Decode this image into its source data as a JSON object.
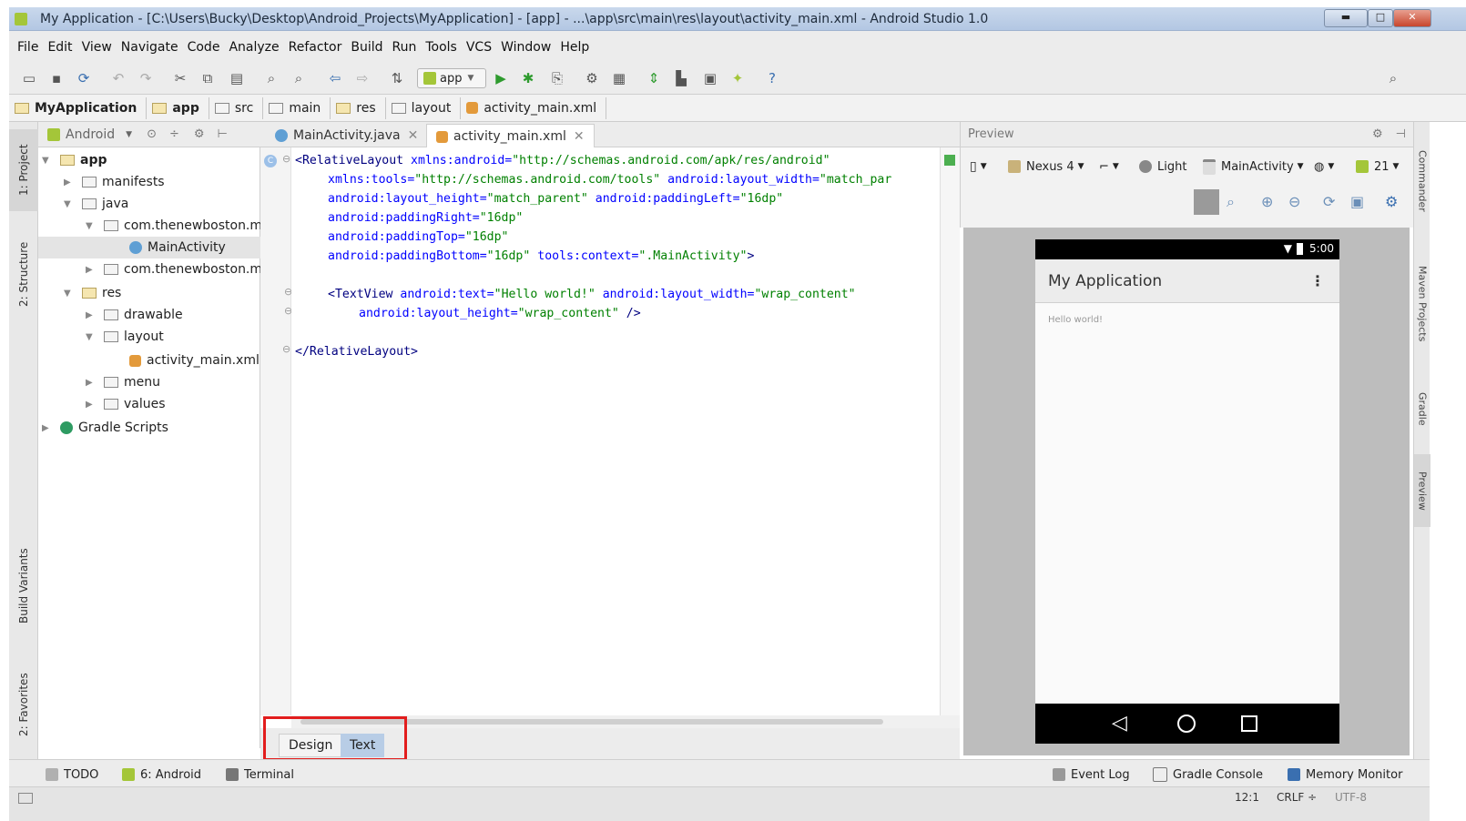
{
  "window": {
    "title": "My Application - [C:\\Users\\Bucky\\Desktop\\Android_Projects\\MyApplication] - [app] - ...\\app\\src\\main\\res\\layout\\activity_main.xml - Android Studio 1.0"
  },
  "menu": [
    "File",
    "Edit",
    "View",
    "Navigate",
    "Code",
    "Analyze",
    "Refactor",
    "Build",
    "Run",
    "Tools",
    "VCS",
    "Window",
    "Help"
  ],
  "toolbar": {
    "run_config": "app",
    "help": "?"
  },
  "breadcrumb": [
    "MyApplication",
    "app",
    "src",
    "main",
    "res",
    "layout",
    "activity_main.xml"
  ],
  "side_tabs": {
    "project": "1: Project",
    "structure": "2: Structure",
    "build_variants": "Build Variants",
    "favorites": "2: Favorites"
  },
  "project_panel": {
    "view": "Android"
  },
  "tree": {
    "app": "app",
    "manifests": "manifests",
    "java": "java",
    "pkg1": "com.thenewboston.m",
    "main_activity": "MainActivity",
    "pkg2": "com.thenewboston.m",
    "res": "res",
    "drawable": "drawable",
    "layout": "layout",
    "activity_main": "activity_main.xml",
    "menu": "menu",
    "values": "values",
    "gradle": "Gradle Scripts"
  },
  "editor_tabs": [
    "MainActivity.java",
    "activity_main.xml"
  ],
  "code": {
    "l1": [
      "<RelativeLayout ",
      "xmlns:android=",
      "\"http://schemas.android.com/apk/res/android\""
    ],
    "l2": [
      "xmlns:tools=",
      "\"http://schemas.android.com/tools\"",
      " android:layout_width=",
      "\"match_par"
    ],
    "l3": [
      "android:layout_height=",
      "\"match_parent\"",
      " android:paddingLeft=",
      "\"16dp\""
    ],
    "l4": [
      "android:paddingRight=",
      "\"16dp\""
    ],
    "l5": [
      "android:paddingTop=",
      "\"16dp\""
    ],
    "l6": [
      "android:paddingBottom=",
      "\"16dp\"",
      " tools:context=",
      "\".MainActivity\"",
      ">"
    ],
    "l8": [
      "<TextView ",
      "android:text=",
      "\"Hello world!\"",
      " android:layout_width=",
      "\"wrap_content\""
    ],
    "l9": [
      "android:layout_height=",
      "\"wrap_content\"",
      " />"
    ],
    "l11": "</RelativeLayout>"
  },
  "design_tabs": {
    "design": "Design",
    "text": "Text"
  },
  "preview": {
    "title": "Preview",
    "device": "Nexus 4",
    "theme": "Light",
    "activity": "MainActivity",
    "api": "21",
    "time": "5:00",
    "app_title": "My Application",
    "hello": "Hello world!"
  },
  "right_tabs": {
    "commander": "Commander",
    "maven": "Maven Projects",
    "gradle": "Gradle",
    "preview": "Preview"
  },
  "bottom_tools": {
    "todo": "TODO",
    "android": "6: Android",
    "terminal": "Terminal",
    "event_log": "Event Log",
    "gradle_console": "Gradle Console",
    "memory_monitor": "Memory Monitor"
  },
  "status": {
    "position": "12:1",
    "line_sep": "CRLF ÷",
    "encoding": "UTF-8"
  },
  "colors": {
    "accent_red": "#e21d1d",
    "xml_attr": "#0000ff",
    "xml_value": "#008000",
    "xml_tag": "#000080"
  }
}
